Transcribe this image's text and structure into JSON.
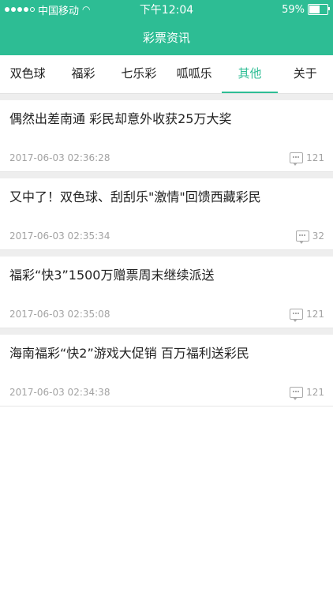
{
  "status": {
    "carrier": "中国移动",
    "time": "下午12:04",
    "battery": "59%",
    "battery_level": 0.59
  },
  "header": {
    "title": "彩票资讯"
  },
  "tabs": [
    {
      "label": "双色球",
      "active": false
    },
    {
      "label": "福彩",
      "active": false
    },
    {
      "label": "七乐彩",
      "active": false
    },
    {
      "label": "呱呱乐",
      "active": false
    },
    {
      "label": "其他",
      "active": true
    },
    {
      "label": "关于",
      "active": false
    }
  ],
  "articles": [
    {
      "title": "偶然出差南通 彩民却意外收获25万大奖",
      "time": "2017-06-03 02:36:28",
      "comments": "121"
    },
    {
      "title": "又中了！双色球、刮刮乐\"激情\"回馈西藏彩民",
      "time": "2017-06-03 02:35:34",
      "comments": "32"
    },
    {
      "title": "福彩“快3”1500万赠票周末继续派送",
      "time": "2017-06-03 02:35:08",
      "comments": "121"
    },
    {
      "title": "海南福彩“快2”游戏大促销 百万福利送彩民",
      "time": "2017-06-03 02:34:38",
      "comments": "121"
    }
  ],
  "colors": {
    "accent": "#2dbd94"
  }
}
